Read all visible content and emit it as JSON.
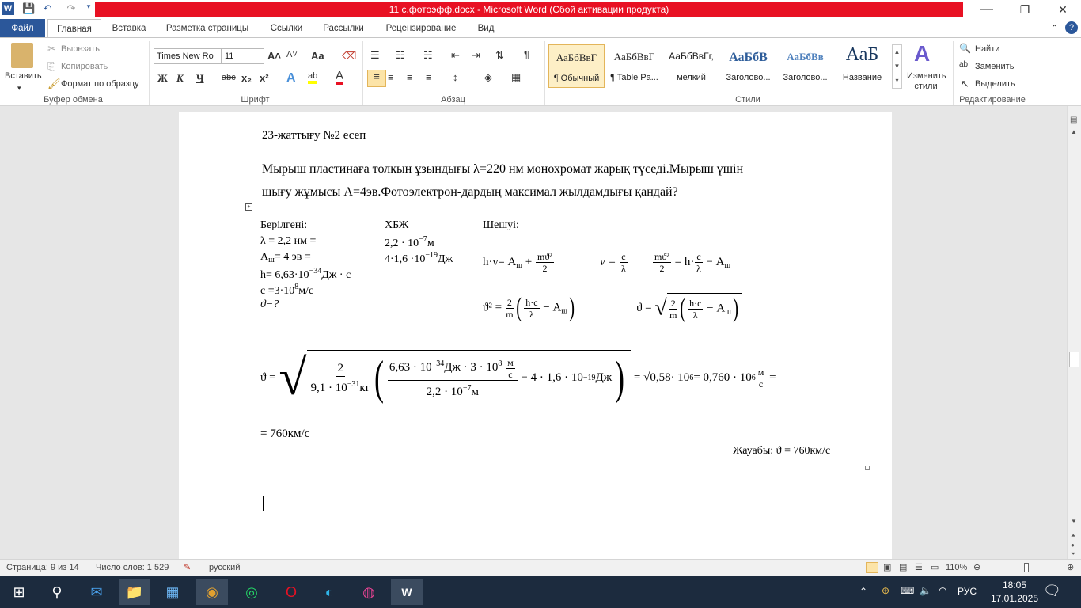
{
  "title_bar": {
    "title": "11 с.фотоэфф.docx  -  Microsoft Word (Сбой активации продукта)",
    "quick_access": [
      "word-icon",
      "save-icon",
      "undo-icon",
      "redo-icon",
      "customize-icon"
    ],
    "controls": {
      "help": "?",
      "minimize": "—",
      "restore": "❐",
      "close": "✕"
    }
  },
  "tabs": [
    "Файл",
    "Главная",
    "Вставка",
    "Разметка страницы",
    "Ссылки",
    "Рассылки",
    "Рецензирование",
    "Вид"
  ],
  "ribbon": {
    "clipboard": {
      "paste": "Вставить",
      "cut": "Вырезать",
      "copy": "Копировать",
      "format_painter": "Формат по образцу",
      "group": "Буфер обмена"
    },
    "font": {
      "name": "Times New Ro",
      "size": "11",
      "bold": "Ж",
      "italic": "К",
      "underline": "Ч",
      "strike": "abc",
      "sub": "x₂",
      "sup": "x²",
      "grow": "A˄",
      "shrink": "A˅",
      "case": "Aa",
      "group": "Шрифт",
      "highlight_color": "#ffff00",
      "font_color": "#e81123"
    },
    "paragraph": {
      "group": "Абзац"
    },
    "styles": {
      "items": [
        {
          "preview": "АаБбВвГ",
          "label": "¶ Обычный"
        },
        {
          "preview": "АаБбВвГ",
          "label": "¶ Table Pa..."
        },
        {
          "preview": "АаБбВвГг,",
          "label": "мелкий"
        },
        {
          "preview": "АаБбВ",
          "label": "Заголово..."
        },
        {
          "preview": "АаБбВв",
          "label": "Заголово..."
        },
        {
          "preview": "АаБ",
          "label": "Название"
        }
      ],
      "change": "Изменить стили",
      "group": "Стили"
    },
    "editing": {
      "find": "Найти",
      "replace": "Заменить",
      "select": "Выделить",
      "group": "Редактирование"
    }
  },
  "document": {
    "heading": "23-жаттығу №2 есеп",
    "problem_line1": "Мырыш пластинаға толқын ұзындығы λ=220 нм монохромат жарық түседі.Мырыш үшін",
    "problem_line2": "шығу жұмысы А=4эв.Фотоэлектрон-дардың максимал жылдамдығы қандай?",
    "given": {
      "title": "Берілгені:",
      "lambda": "λ = 2,2 нм =",
      "work": {
        "pre": " А",
        "sub": "ш",
        "post": "= 4 эв ="
      },
      "h": {
        "pre": "h= 6,63·10",
        "exp": "−34",
        "post": "Дж · с"
      },
      "c": {
        "pre": "c =3·10",
        "exp": "8",
        "post": "м/с"
      },
      "find": "ϑ−?"
    },
    "si": {
      "title": "ХБЖ",
      "lambda": {
        "pre": "2,2  · 10",
        "exp": "−7",
        "post": "м"
      },
      "work": {
        "pre": "4·1,6 ·10",
        "exp": "−19",
        "post": "Дж"
      }
    },
    "solution": {
      "title": "Шешуі:",
      "eq1": {
        "lhs": "h·ν= А",
        "sub": "ш",
        "plus": "+",
        "num": "mϑ²",
        "den": "2"
      },
      "eq2": {
        "lhs": "ν =",
        "num": "c",
        "den": "λ"
      },
      "eq3": {
        "num": "mϑ²",
        "den": "2",
        "mid": "= h·",
        "fnum": "c",
        "fden": "λ",
        "tail": "− А",
        "sub": "ш"
      },
      "eq4": {
        "lhs": "ϑ² =",
        "num": "2",
        "den": "m",
        "inum": "h·c",
        "iden": "λ",
        "tail": "− А",
        "sub": "ш"
      },
      "eq5": {
        "lhs": "ϑ =",
        "num": "2",
        "den": "m",
        "inum": "h·c",
        "iden": "λ",
        "tail": "− А",
        "sub": "ш"
      }
    },
    "calc": {
      "lhs": "ϑ =",
      "num": "2",
      "den": {
        "pre": "9,1 · 10",
        "exp": "−31",
        "post": "кг"
      },
      "inner_num": {
        "pre": "6,63 · 10",
        "exp": "−34",
        "mid": "Дж  · 3 · 10",
        "exp2": "8",
        "unum": "м",
        "uden": "с"
      },
      "inner_den": {
        "pre": "2,2 · 10",
        "exp": "−7",
        "post": "м"
      },
      "minus": {
        "pre": "−  4 · 1,6  · 10",
        "exp": "−19",
        "post": "Дж"
      },
      "rhs1": "=",
      "root": "0,58",
      "rhs2": {
        "pre": "· 10",
        "exp": "6",
        "mid": " = 0,760 · 10",
        "exp2": "6"
      },
      "unit_num": "м",
      "unit_den": "с",
      "end": "="
    },
    "result_line": "= 760км/с",
    "answer": "Жауабы: ϑ = 760км/с"
  },
  "status_bar": {
    "page": "Страница: 9 из 14",
    "words": "Число слов: 1 529",
    "language": "русский",
    "zoom": "110%",
    "zoom_level_percent": 110
  },
  "taskbar": {
    "language": "РУС",
    "time": "18:05",
    "date": "17.01.2025"
  }
}
